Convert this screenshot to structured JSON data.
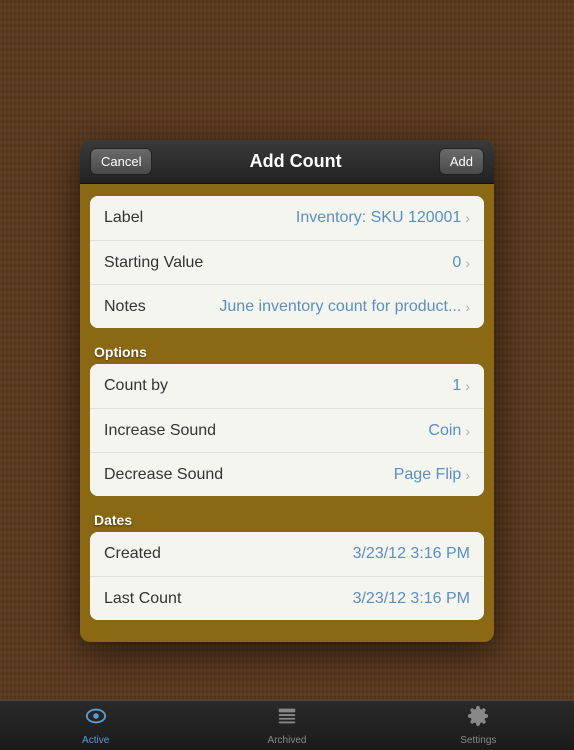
{
  "modal": {
    "title": "Add Count",
    "cancel_label": "Cancel",
    "add_label": "Add"
  },
  "rows": {
    "label": {
      "key": "Label",
      "value": "Inventory: SKU 120001"
    },
    "starting_value": {
      "key": "Starting Value",
      "value": "0"
    },
    "notes": {
      "key": "Notes",
      "value": "June inventory count for product..."
    }
  },
  "options_section": {
    "header": "Options",
    "count_by": {
      "key": "Count by",
      "value": "1"
    },
    "increase_sound": {
      "key": "Increase Sound",
      "value": "Coin"
    },
    "decrease_sound": {
      "key": "Decrease Sound",
      "value": "Page Flip"
    }
  },
  "dates_section": {
    "header": "Dates",
    "created": {
      "key": "Created",
      "value": "3/23/12 3:16 PM"
    },
    "last_count": {
      "key": "Last Count",
      "value": "3/23/12 3:16 PM"
    }
  },
  "tab_bar": {
    "active_tab": "active",
    "tabs": [
      {
        "id": "active",
        "label": "Active"
      },
      {
        "id": "archived",
        "label": "Archived"
      },
      {
        "id": "settings",
        "label": "Settings"
      }
    ]
  }
}
